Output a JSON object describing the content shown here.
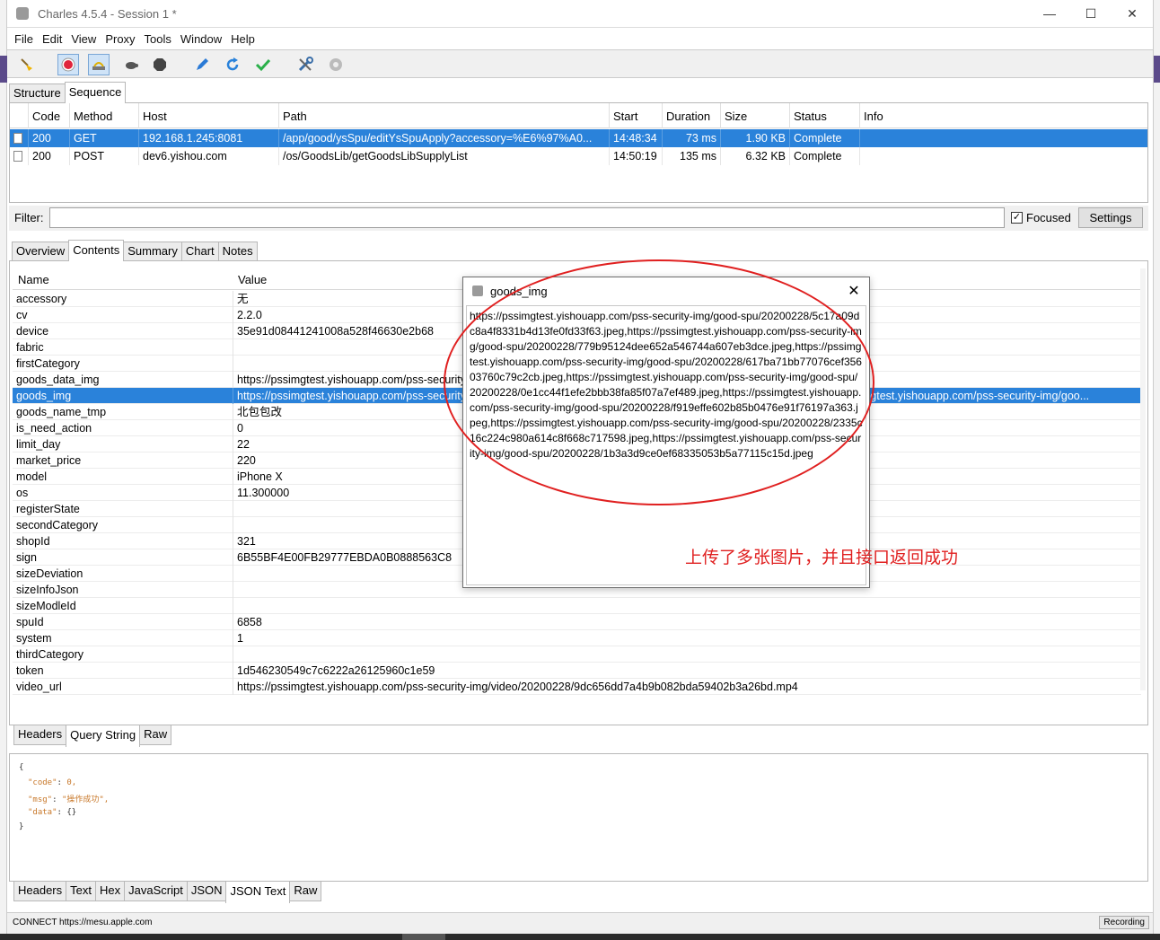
{
  "window": {
    "title": "Charles 4.5.4 - Session 1 *",
    "controls": [
      "—",
      "☐",
      "✕"
    ]
  },
  "menu": [
    "File",
    "Edit",
    "View",
    "Proxy",
    "Tools",
    "Window",
    "Help"
  ],
  "toolbar_icons": [
    "broom-icon",
    "record-icon",
    "throttle-icon",
    "turtle-icon",
    "breakpoint-icon",
    "compose-pen-icon",
    "repeat-icon",
    "validate-check-icon",
    "tools-icon",
    "settings-gear-icon"
  ],
  "top_tabs": [
    "Structure",
    "Sequence"
  ],
  "sequence": {
    "columns": [
      "Code",
      "Method",
      "Host",
      "Path",
      "Start",
      "Duration",
      "Size",
      "Status",
      "Info"
    ],
    "rows": [
      {
        "code": "200",
        "method": "GET",
        "host": "192.168.1.245:8081",
        "path": "/app/good/ysSpu/editYsSpuApply?accessory=%E6%97%A0...",
        "start": "14:48:34",
        "duration": "73 ms",
        "size": "1.90 KB",
        "status": "Complete",
        "info": ""
      },
      {
        "code": "200",
        "method": "POST",
        "host": "dev6.yishou.com",
        "path": "/os/GoodsLib/getGoodsLibSupplyList",
        "start": "14:50:19",
        "duration": "135 ms",
        "size": "6.32 KB",
        "status": "Complete",
        "info": ""
      }
    ]
  },
  "filter": {
    "label": "Filter:",
    "value": "",
    "focused_label": "Focused",
    "focused_checked": "✓",
    "settings_label": "Settings"
  },
  "detail_tabs": [
    "Overview",
    "Contents",
    "Summary",
    "Chart",
    "Notes"
  ],
  "params": {
    "columns": [
      "Name",
      "Value"
    ],
    "rows": [
      {
        "name": "accessory",
        "value": "无"
      },
      {
        "name": "cv",
        "value": "2.2.0"
      },
      {
        "name": "device",
        "value": "35e91d08441241008a528f46630e2b68"
      },
      {
        "name": "fabric",
        "value": ""
      },
      {
        "name": "firstCategory",
        "value": ""
      },
      {
        "name": "goods_data_img",
        "value": "https://pssimgtest.yishouapp.com/pss-security-img/good-spu/20200228/..."
      },
      {
        "name": "goods_img",
        "value": "https://pssimgtest.yishouapp.com/pss-security-img/good-spu/20200228/5c17a09dc8a4f8331b4d13fe0fd33f63.jpeg,https://pssimgtest.yishouapp.com/pss-security-img/goo..."
      },
      {
        "name": "goods_name_tmp",
        "value": "北包包改"
      },
      {
        "name": "is_need_action",
        "value": "0"
      },
      {
        "name": "limit_day",
        "value": "22"
      },
      {
        "name": "market_price",
        "value": "220"
      },
      {
        "name": "model",
        "value": "iPhone X"
      },
      {
        "name": "os",
        "value": "11.300000"
      },
      {
        "name": "registerState",
        "value": ""
      },
      {
        "name": "secondCategory",
        "value": ""
      },
      {
        "name": "shopId",
        "value": "321"
      },
      {
        "name": "sign",
        "value": "6B55BF4E00FB29777EBDA0B0888563C8"
      },
      {
        "name": "sizeDeviation",
        "value": ""
      },
      {
        "name": "sizeInfoJson",
        "value": ""
      },
      {
        "name": "sizeModleId",
        "value": ""
      },
      {
        "name": "spuId",
        "value": "6858"
      },
      {
        "name": "system",
        "value": "1"
      },
      {
        "name": "thirdCategory",
        "value": ""
      },
      {
        "name": "token",
        "value": "1d546230549c7c6222a26125960c1e59"
      },
      {
        "name": "video_url",
        "value": "https://pssimgtest.yishouapp.com/pss-security-img/video/20200228/9dc656dd7a4b9b082bda59402b3a26bd.mp4"
      }
    ]
  },
  "request_tabs": [
    "Headers",
    "Query String",
    "Raw"
  ],
  "response_json": {
    "open": "{",
    "code_key": "\"code\"",
    "code_val": "0,",
    "msg_key": "\"msg\"",
    "msg_val": "\"操作成功\",",
    "data_key": "\"data\"",
    "data_val": "{}",
    "close": "}"
  },
  "response_tabs": [
    "Headers",
    "Text",
    "Hex",
    "JavaScript",
    "JSON",
    "JSON Text",
    "Raw"
  ],
  "statusbar": {
    "message": "CONNECT https://mesu.apple.com",
    "recording": "Recording"
  },
  "popup": {
    "title": "goods_img",
    "close": "✕",
    "body": "https://pssimgtest.yishouapp.com/pss-security-img/good-spu/20200228/5c17a09dc8a4f8331b4d13fe0fd33f63.jpeg,https://pssimgtest.yishouapp.com/pss-security-img/good-spu/20200228/779b95124dee652a546744a607eb3dce.jpeg,https://pssimgtest.yishouapp.com/pss-security-img/good-spu/20200228/617ba71bb77076cef35603760c79c2cb.jpeg,https://pssimgtest.yishouapp.com/pss-security-img/good-spu/20200228/0e1cc44f1efe2bbb38fa85f07a7ef489.jpeg,https://pssimgtest.yishouapp.com/pss-security-img/good-spu/20200228/f919effe602b85b0476e91f76197a363.jpeg,https://pssimgtest.yishouapp.com/pss-security-img/good-spu/20200228/2335c16c224c980a614c8f668c717598.jpeg,https://pssimgtest.yishouapp.com/pss-security-img/good-spu/20200228/1b3a3d9ce0ef68335053b5a77115c15d.jpeg"
  },
  "annotation": "上传了多张图片，并且接口返回成功",
  "colors": {
    "selection": "#2a82da",
    "annotation": "#e02020",
    "record": "#e0243b",
    "json_key": "#c8782a"
  }
}
